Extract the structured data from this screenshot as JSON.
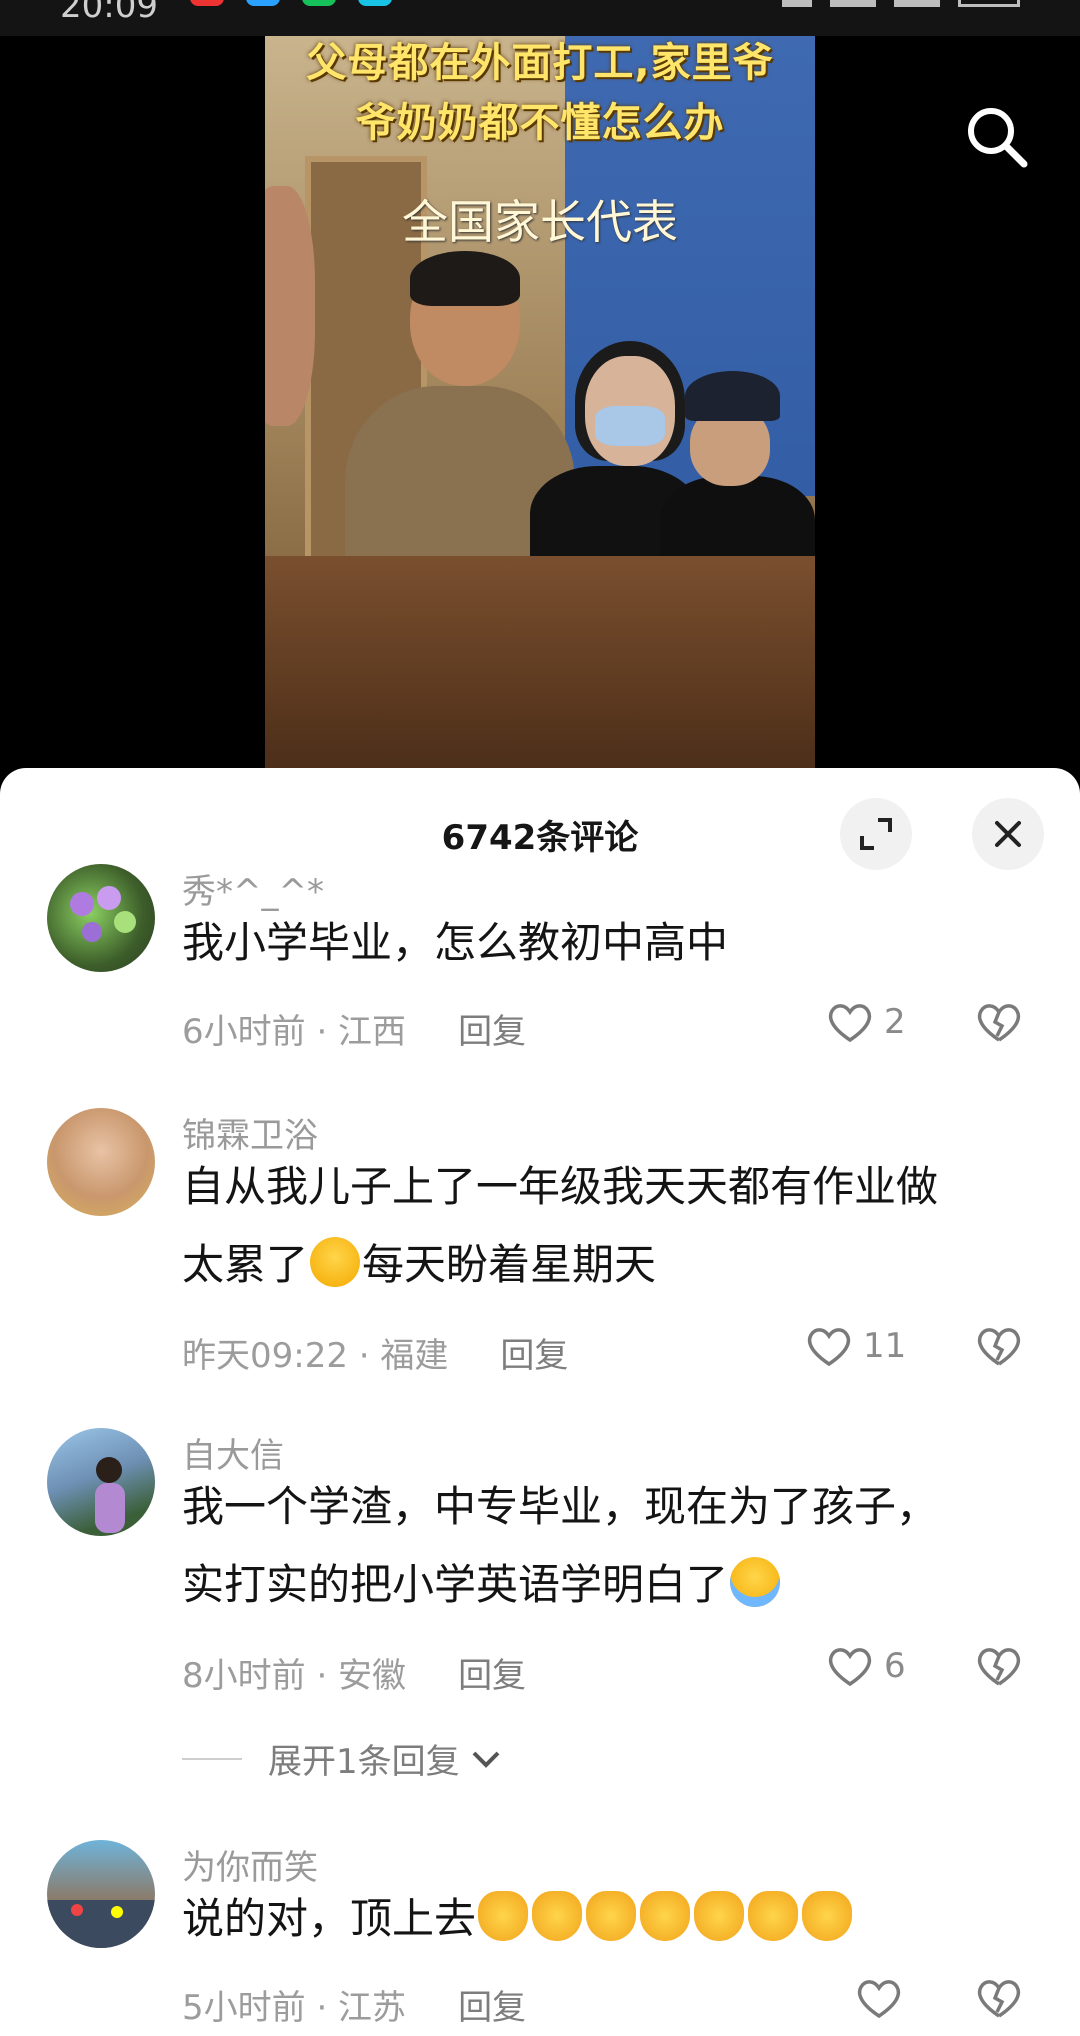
{
  "status_bar": {
    "time": "20:09"
  },
  "video": {
    "overlay_line1": "父母都在外面打工,家里爷",
    "overlay_line2": "爷奶奶都不懂怎么办",
    "overlay_subtitle": "全国家长代表",
    "search_icon": "search-icon"
  },
  "comments_panel": {
    "title": "6742条评论",
    "expand_icon": "expand-icon",
    "close_icon": "close-icon"
  },
  "comments": [
    {
      "username": "秀*^_^*",
      "text": "我小学毕业，怎么教初中高中",
      "meta": "6小时前 · 江西",
      "reply": "回复",
      "likes": "2"
    },
    {
      "username": "锦霖卫浴",
      "text_line1": "自从我儿子上了一年级我天天都有作业做",
      "text_line2_a": "太累了",
      "text_line2_b": "每天盼着星期天",
      "meta": "昨天09:22 · 福建",
      "reply": "回复",
      "likes": "11"
    },
    {
      "username": "自大信",
      "text_line1": "我一个学渣，中专毕业，现在为了孩子，",
      "text_line2": "实打实的把小学英语学明白了",
      "meta": "8小时前 · 安徽",
      "reply": "回复",
      "likes": "6",
      "expand_replies": "展开1条回复"
    },
    {
      "username": "为你而笑",
      "text": "说的对，顶上去",
      "meta": "5小时前 · 江苏",
      "reply": "回复",
      "likes": ""
    }
  ],
  "colors": {
    "sheet_bg": "#ffffff",
    "overlay_text": "#ffe56a",
    "muted_text": "#9a9a9a"
  }
}
